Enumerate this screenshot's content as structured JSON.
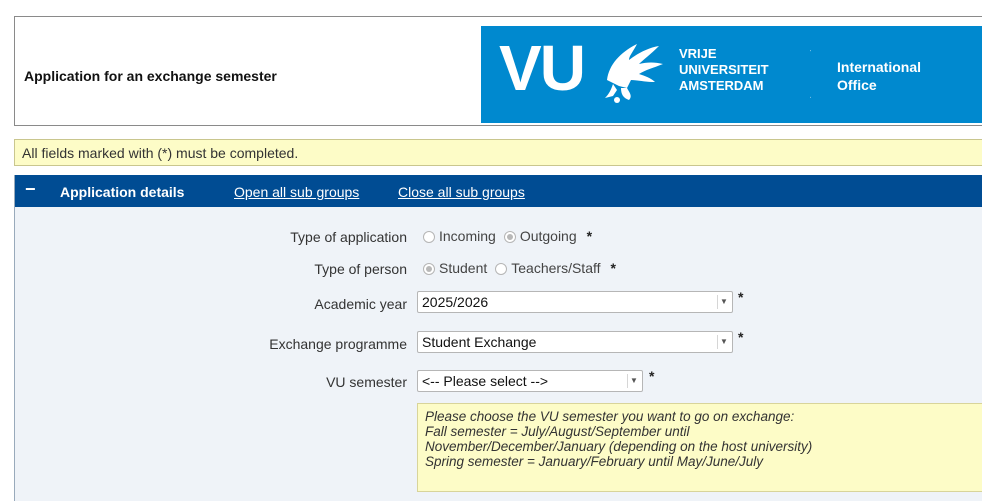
{
  "header": {
    "title": "Application for an exchange semester",
    "logo_letters": "VU",
    "logo_lines": [
      "VRIJE",
      "UNIVERSITEIT",
      "AMSTERDAM"
    ],
    "office_lines": [
      "International",
      "Office"
    ],
    "brand_color": "#0089cf"
  },
  "notice": {
    "text": "All fields marked with (*) must be completed."
  },
  "panel": {
    "collapse_symbol": "−",
    "title": "Application details",
    "open_all": "Open all sub groups",
    "close_all": "Close all sub groups",
    "header_color": "#004c93"
  },
  "form": {
    "type_of_application": {
      "label": "Type of application",
      "options": [
        "Incoming",
        "Outgoing"
      ],
      "selected": "Outgoing",
      "required": "*"
    },
    "type_of_person": {
      "label": "Type of person",
      "options": [
        "Student",
        "Teachers/Staff"
      ],
      "selected": "Student",
      "required": "*"
    },
    "academic_year": {
      "label": "Academic year",
      "value": "2025/2026",
      "required": "*"
    },
    "exchange_programme": {
      "label": "Exchange programme",
      "value": "Student Exchange",
      "required": "*"
    },
    "vu_semester": {
      "label": "VU semester",
      "value": "<-- Please select -->",
      "required": "*"
    }
  },
  "hint": {
    "lines": [
      "Please choose the VU semester you want to go on exchange:",
      "Fall semester = July/August/September until",
      "November/December/January (depending on the host university)",
      "Spring semester = January/February until May/June/July"
    ]
  }
}
